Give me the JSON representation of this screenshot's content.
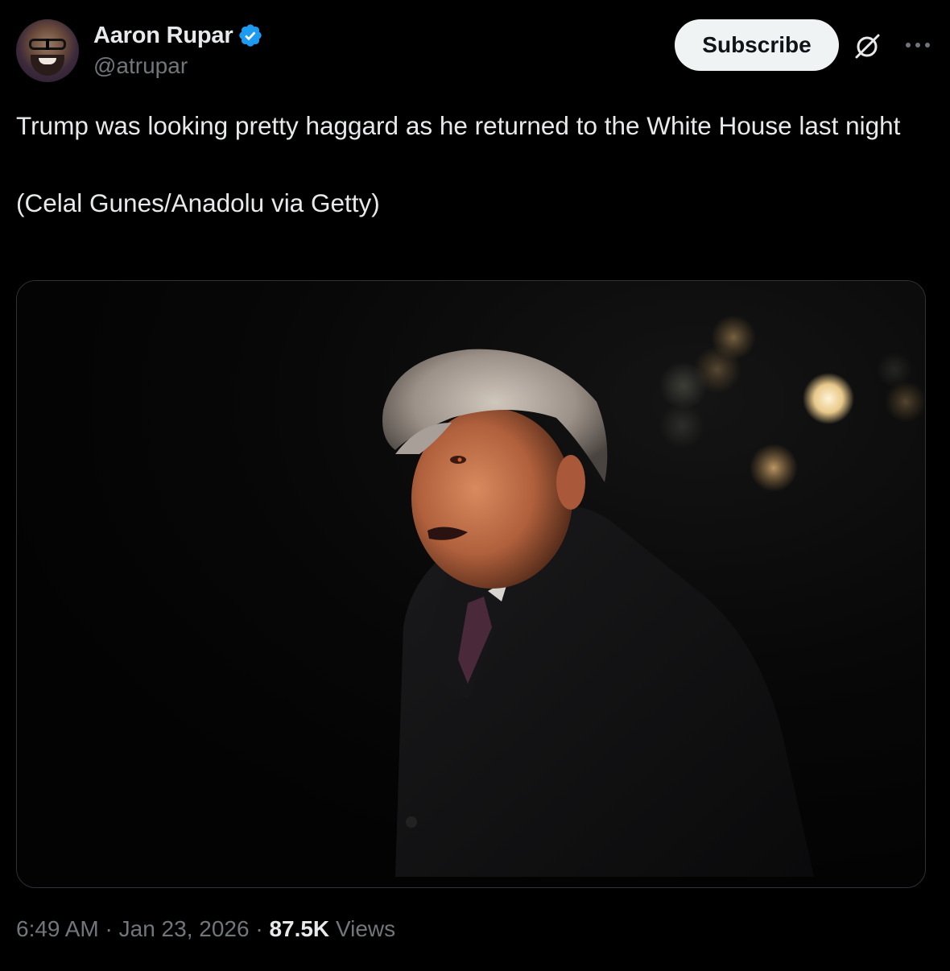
{
  "author": {
    "display_name": "Aaron Rupar",
    "handle": "@atrupar",
    "verified": true
  },
  "header": {
    "subscribe_label": "Subscribe",
    "grok_icon": "grok-icon",
    "more_icon": "more-icon"
  },
  "tweet": {
    "text": "Trump was looking pretty haggard as he returned to the White House last night\n\n(Celal Gunes/Anadolu via Getty)"
  },
  "media": {
    "type": "photo",
    "description_icon": "photo"
  },
  "meta": {
    "time": "6:49 AM",
    "separator": "·",
    "date": "Jan 23, 2026",
    "views_count": "87.5K",
    "views_label": "Views"
  },
  "colors": {
    "background": "#000000",
    "text_primary": "#e7e9ea",
    "text_secondary": "#71767b",
    "verified_blue": "#1d9bf0",
    "button_bg": "#eff3f4",
    "border": "#2f3336"
  }
}
